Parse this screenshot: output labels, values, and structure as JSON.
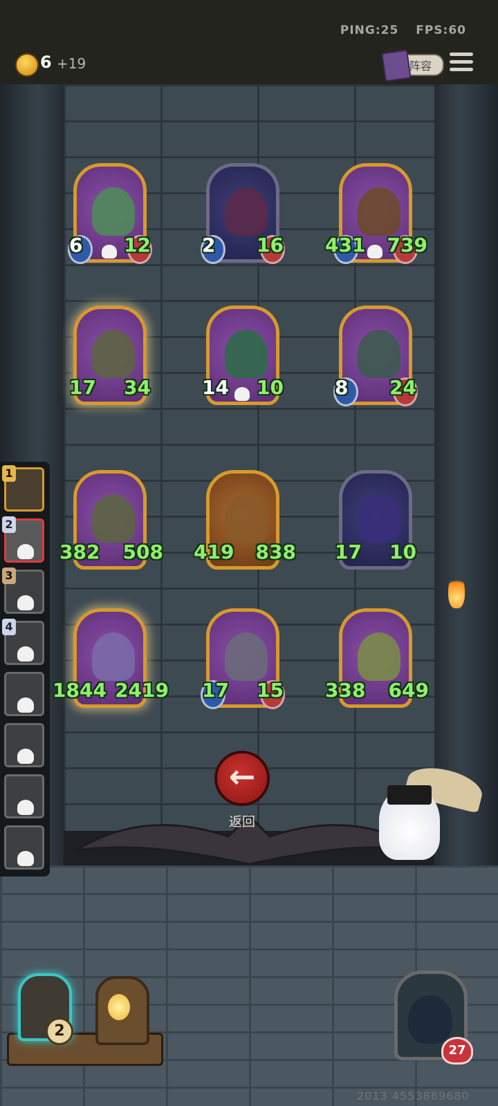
{
  "status": {
    "ping": "PING:25",
    "fps": "FPS:60"
  },
  "resources": {
    "coins": "6",
    "coins_income": "+19"
  },
  "header": {
    "lineup_label": "阵容"
  },
  "board": {
    "cards": [
      {
        "atk": "6",
        "hp": "12",
        "frame": "gold"
      },
      {
        "atk": "2",
        "hp": "16",
        "frame": "silver"
      },
      {
        "atk": "431",
        "hp": "739",
        "frame": "gold"
      },
      {
        "atk": "17",
        "hp": "34",
        "frame": "gold"
      },
      {
        "atk": "14",
        "hp": "10",
        "frame": "gold"
      },
      {
        "atk": "8",
        "hp": "24",
        "frame": "gold"
      },
      {
        "atk": "382",
        "hp": "508",
        "frame": "gold"
      },
      {
        "atk": "419",
        "hp": "838",
        "frame": "gold"
      },
      {
        "atk": "17",
        "hp": "10",
        "frame": "silver"
      },
      {
        "atk": "1844",
        "hp": "2419",
        "frame": "gold"
      },
      {
        "atk": "17",
        "hp": "15",
        "frame": "gold"
      },
      {
        "atk": "338",
        "hp": "649",
        "frame": "gold"
      }
    ]
  },
  "sidebar": {
    "slots": [
      {
        "number": "1"
      },
      {
        "number": "2"
      },
      {
        "number": "3"
      },
      {
        "number": "4"
      },
      {
        "number": ""
      },
      {
        "number": ""
      },
      {
        "number": ""
      },
      {
        "number": ""
      }
    ]
  },
  "actions": {
    "back_label": "返回",
    "back_icon": "←"
  },
  "inventory": {
    "item1_count": "2"
  },
  "player": {
    "health": "27"
  },
  "footer": {
    "seed": "2013 4553869680"
  }
}
